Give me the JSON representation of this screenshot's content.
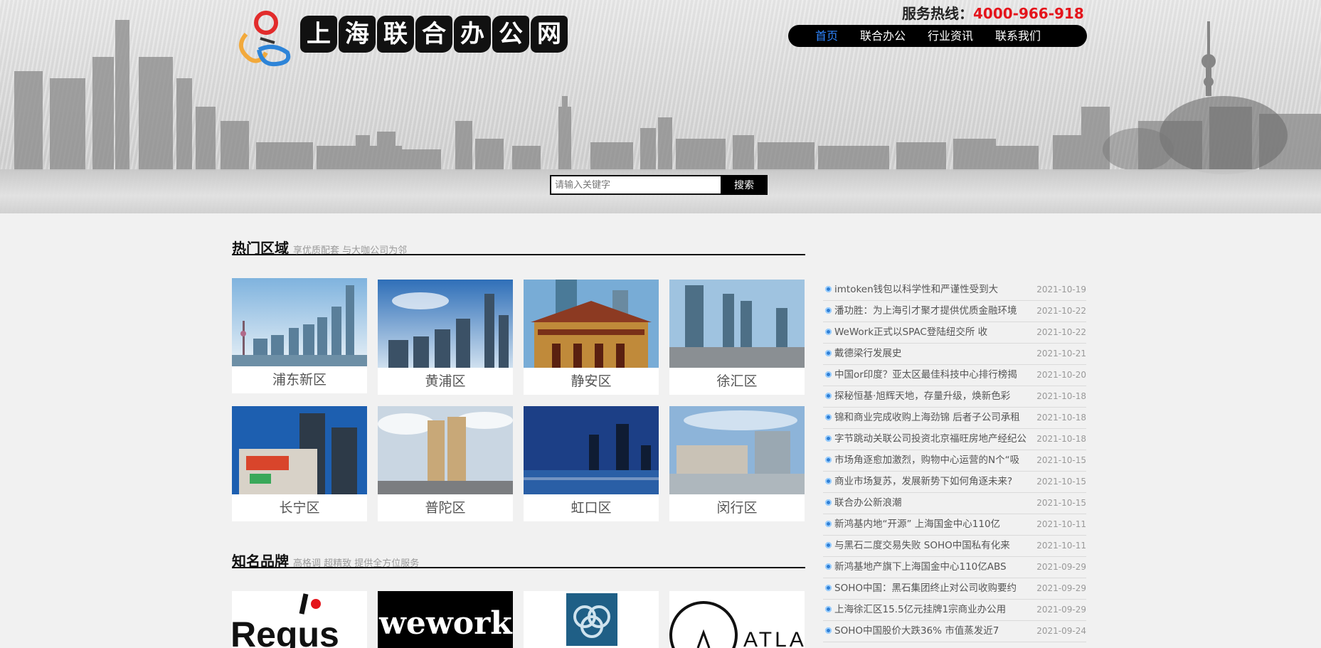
{
  "header": {
    "logo_text": [
      "上",
      "海",
      "联",
      "合",
      "办",
      "公",
      "网"
    ],
    "hotline_label": "服务热线：",
    "hotline_number": "4000-966-918",
    "nav": [
      {
        "label": "首页",
        "active": true
      },
      {
        "label": "联合办公",
        "active": false
      },
      {
        "label": "行业资讯",
        "active": false
      },
      {
        "label": "联系我们",
        "active": false
      }
    ],
    "search_placeholder": "请输入关键字",
    "search_button": "搜索"
  },
  "hot_areas": {
    "title": "热门区域",
    "subtitle": "享优质配套 与大咖公司为邻",
    "items": [
      "浦东新区",
      "黄浦区",
      "静安区",
      "徐汇区",
      "长宁区",
      "普陀区",
      "虹口区",
      "闵行区"
    ]
  },
  "brands": {
    "title": "知名品牌",
    "subtitle": "高格调 超精致 提供全方位服务",
    "items": [
      "Regus",
      "wework",
      "",
      "ATLAS"
    ]
  },
  "news": [
    {
      "title": "imtoken钱包以科学性和严谨性受到大",
      "date": "2021-10-19"
    },
    {
      "title": "潘功胜：为上海引才聚才提供优质金融环境",
      "date": "2021-10-22"
    },
    {
      "title": "WeWork正式以SPAC登陆纽交所 收",
      "date": "2021-10-22"
    },
    {
      "title": "戴德梁行发展史",
      "date": "2021-10-21"
    },
    {
      "title": "中国or印度？亚太区最佳科技中心排行榜揭",
      "date": "2021-10-20"
    },
    {
      "title": "探秘恒基·旭辉天地，存量升级，焕新色彩",
      "date": "2021-10-18"
    },
    {
      "title": "锦和商业完成收购上海劲锦 后者子公司承租",
      "date": "2021-10-18"
    },
    {
      "title": "字节跳动关联公司投资北京福旺房地产经纪公",
      "date": "2021-10-18"
    },
    {
      "title": "市场角逐愈加激烈，购物中心运营的N个“吸",
      "date": "2021-10-15"
    },
    {
      "title": "商业市场复苏，发展新势下如何角逐未来?",
      "date": "2021-10-15"
    },
    {
      "title": "联合办公新浪潮",
      "date": "2021-10-15"
    },
    {
      "title": "新鸿基内地“开源” 上海国金中心110亿",
      "date": "2021-10-11"
    },
    {
      "title": "与黑石二度交易失败 SOHO中国私有化来",
      "date": "2021-10-11"
    },
    {
      "title": "新鸿基地产旗下上海国金中心110亿ABS",
      "date": "2021-09-29"
    },
    {
      "title": "SOHO中国：黑石集团终止对公司收购要约",
      "date": "2021-09-29"
    },
    {
      "title": "上海徐汇区15.5亿元挂牌1宗商业办公用",
      "date": "2021-09-29"
    },
    {
      "title": "SOHO中国股价大跌36% 市值蒸发近7",
      "date": "2021-09-24"
    }
  ],
  "colors": {
    "accent_red": "#e4141b",
    "nav_active": "#2f86ff",
    "background": "#f1f1f1"
  }
}
